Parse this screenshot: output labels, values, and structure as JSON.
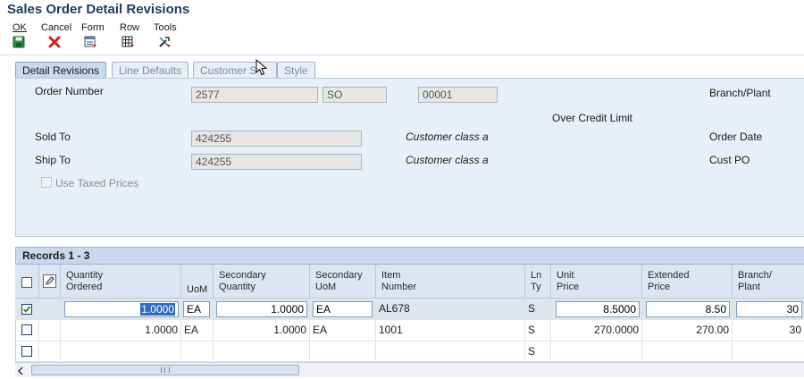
{
  "title": "Sales Order Detail Revisions",
  "toolbar": {
    "ok_label": "OK",
    "cancel_label": "Cancel",
    "form_label": "Form",
    "row_label": "Row",
    "tools_label": "Tools"
  },
  "tabs": [
    "Detail Revisions",
    "Line Defaults",
    "Customer S",
    "Style"
  ],
  "form": {
    "order_number_label": "Order Number",
    "order_number": "2577",
    "order_type": "SO",
    "order_company": "00001",
    "branch_plant_label": "Branch/Plant",
    "over_credit_limit": "Over Credit Limit",
    "sold_to_label": "Sold To",
    "sold_to": "424255",
    "sold_to_class": "Customer class a",
    "order_date_label": "Order Date",
    "ship_to_label": "Ship To",
    "ship_to": "424255",
    "ship_to_class": "Customer class a",
    "cust_po_label": "Cust PO",
    "use_taxed_prices_label": "Use Taxed Prices"
  },
  "grid": {
    "records_label": "Records 1 - 3",
    "headers": [
      "Quantity Ordered",
      "UoM",
      "Secondary Quantity",
      "Secondary UoM",
      "Item Number",
      "Ln Ty",
      "Unit Price",
      "Extended Price",
      "Branch/ Plant"
    ],
    "header_lines": [
      [
        "Quantity",
        "Ordered"
      ],
      [
        "UoM",
        ""
      ],
      [
        "Secondary",
        "Quantity"
      ],
      [
        "Secondary",
        "UoM"
      ],
      [
        "Item",
        "Number"
      ],
      [
        "Ln",
        "Ty"
      ],
      [
        "Unit",
        "Price"
      ],
      [
        "Extended",
        "Price"
      ],
      [
        "Branch/",
        "Plant"
      ]
    ],
    "rows": [
      {
        "checked": true,
        "qty": "1.0000",
        "uom": "EA",
        "sec_qty": "1.0000",
        "sec_uom": "EA",
        "item": "AL678",
        "ln_ty": "S",
        "unit_price": "8.5000",
        "ext_price": "8.50",
        "branch": "30"
      },
      {
        "checked": false,
        "qty": "1.0000",
        "uom": "EA",
        "sec_qty": "1.0000",
        "sec_uom": "EA",
        "item": "1001",
        "ln_ty": "S",
        "unit_price": "270.0000",
        "ext_price": "270.00",
        "branch": "30"
      },
      {
        "checked": false,
        "qty": "",
        "uom": "",
        "sec_qty": "",
        "sec_uom": "",
        "item": "",
        "ln_ty": "S",
        "unit_price": "",
        "ext_price": "",
        "branch": ""
      }
    ]
  }
}
